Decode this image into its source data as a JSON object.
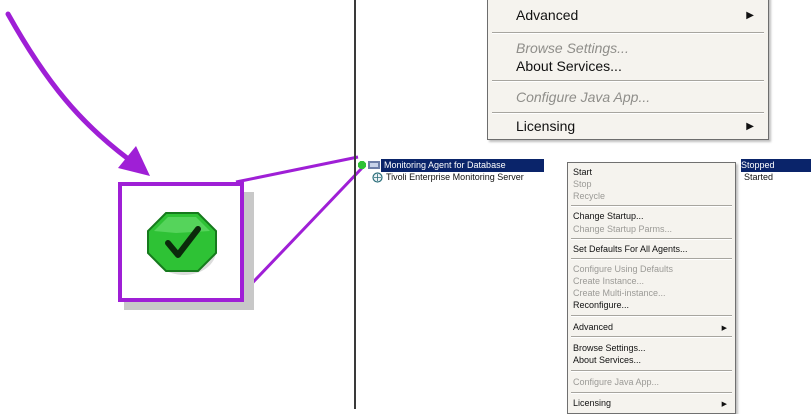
{
  "top_menu": {
    "items": [
      {
        "label": "Advanced",
        "disabled": false,
        "submenu": true
      },
      {
        "label": "Browse Settings...",
        "disabled": true,
        "submenu": false
      },
      {
        "label": "About Services...",
        "disabled": false,
        "submenu": false
      },
      {
        "label": "Configure Java App...",
        "disabled": true,
        "submenu": false
      },
      {
        "label": "Licensing",
        "disabled": false,
        "submenu": true
      }
    ]
  },
  "services": [
    {
      "name": "Monitoring Agent for Database",
      "status": "Stopped",
      "selected": true,
      "icon": "agent-icon"
    },
    {
      "name": "Tivoli Enterprise Monitoring Server",
      "status": "Started",
      "selected": false,
      "icon": "server-icon"
    }
  ],
  "context_menu": {
    "items": [
      {
        "label": "Start",
        "disabled": false
      },
      {
        "label": "Stop",
        "disabled": true
      },
      {
        "label": "Recycle",
        "disabled": true
      },
      {
        "label": "Change Startup...",
        "disabled": false
      },
      {
        "label": "Change Startup Parms...",
        "disabled": true
      },
      {
        "label": "Set Defaults For All Agents...",
        "disabled": false
      },
      {
        "label": "Configure Using Defaults",
        "disabled": true
      },
      {
        "label": "Create Instance...",
        "disabled": true
      },
      {
        "label": "Create Multi-instance...",
        "disabled": true
      },
      {
        "label": "Reconfigure...",
        "disabled": false
      },
      {
        "label": "Advanced",
        "disabled": false,
        "submenu": true
      },
      {
        "label": "Browse Settings...",
        "disabled": false
      },
      {
        "label": "About Services...",
        "disabled": false
      },
      {
        "label": "Configure Java App...",
        "disabled": true
      },
      {
        "label": "Licensing",
        "disabled": false,
        "submenu": true
      }
    ]
  },
  "colors": {
    "annotation": "#9f1fd6",
    "status_ok": "#2ec235",
    "selection": "#0a246a"
  },
  "icons": {
    "submenu_arrow": "▶",
    "zoomed_status": "green-check-octagon-icon"
  }
}
